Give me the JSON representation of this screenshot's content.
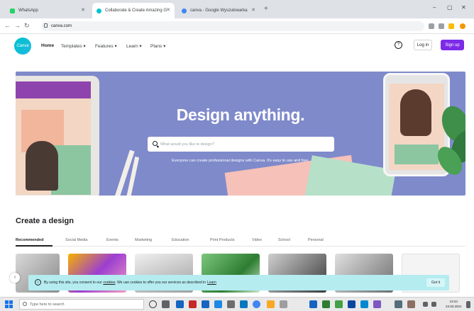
{
  "browser": {
    "tabs": [
      {
        "title": "WhatsApp",
        "color": "#25d366",
        "active": false
      },
      {
        "title": "Collaborate & Create Amazing G",
        "color": "#00c4cc",
        "active": true
      },
      {
        "title": "canva - Google Wyszukiwarka",
        "color": "#4285f4",
        "active": false
      }
    ],
    "new_tab": "+",
    "url": "canva.com"
  },
  "header": {
    "logo_text": "Canva",
    "nav": [
      "Home",
      "Templates ▾",
      "Features ▾",
      "Learn ▾",
      "Plans ▾"
    ],
    "help": "?",
    "login": "Log in",
    "signup": "Sign up"
  },
  "hero": {
    "title": "Design anything.",
    "search_placeholder": "What would you like to design?",
    "subtitle": "Everyone can create professional designs with Canva. It's easy to use and free."
  },
  "create": {
    "title": "Create a design",
    "categories": [
      "Recommended",
      "Social Media",
      "Events",
      "Marketing",
      "Education",
      "Video",
      "Print Products",
      "Video",
      "School",
      "Personal"
    ]
  },
  "cookie": {
    "text": "By using this site, you consent to our",
    "link1": "cookies",
    "text2": ". We use cookies to offer you our services as described in",
    "link2": "Learn",
    "ok": "Got it"
  },
  "taskbar": {
    "search": "Type here to search",
    "time": "13:44",
    "date": "23.03.2021"
  }
}
